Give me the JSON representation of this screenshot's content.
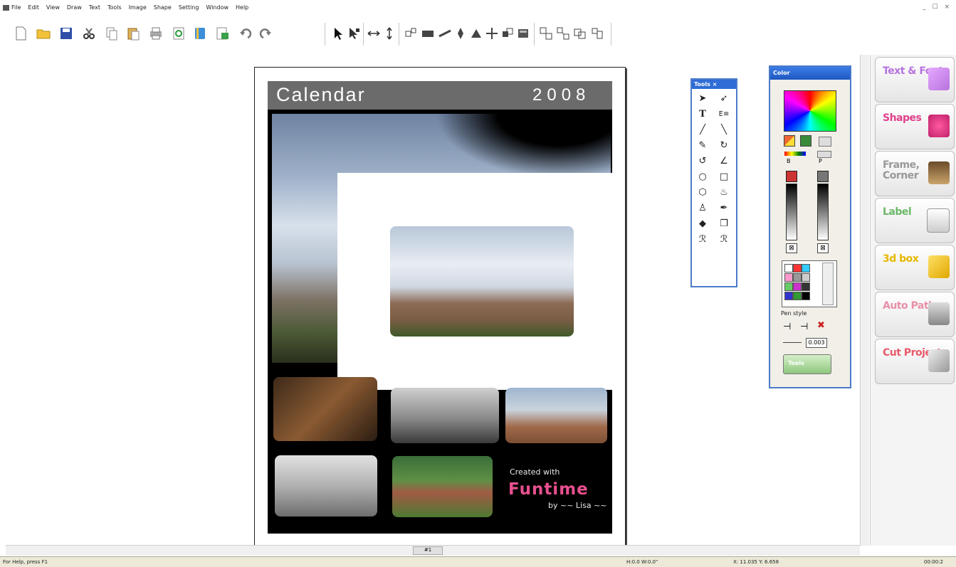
{
  "menu": {
    "items": [
      "File",
      "Edit",
      "View",
      "Draw",
      "Text",
      "Tools",
      "Image",
      "Shape",
      "Setting",
      "Window",
      "Help"
    ],
    "window_controls": "_ ☐ ×"
  },
  "toolbar": {
    "buttons": [
      "new-file",
      "open-folder",
      "save",
      "cut",
      "copy",
      "paste",
      "print",
      "refresh",
      "book",
      "export",
      "undo",
      "redo",
      "select",
      "pointer",
      "flip-horizontal",
      "flip-vertical",
      "align",
      "rectangle",
      "line",
      "point",
      "shape",
      "move",
      "send-back",
      "layer",
      "group",
      "ungroup",
      "combine",
      "arrange"
    ]
  },
  "calendar": {
    "title": "Calendar",
    "year": "2008",
    "created_with": "Created with",
    "brand": "Funtime",
    "byline": "by ~~ Lisa ~~"
  },
  "tools_window": {
    "title": "Tools",
    "close": "×",
    "icons": [
      "arrow-icon",
      "node-icon",
      "text-icon",
      "art-text-icon",
      "line-icon",
      "diagonal-icon",
      "pen-icon",
      "curve-icon",
      "arc-icon",
      "angle-icon",
      "ellipse-icon",
      "rect-icon",
      "polygon-icon",
      "fill-icon",
      "stamp-icon",
      "brush-icon",
      "eraser-icon",
      "copy-icon",
      "zoom-in-icon",
      "zoom-out-icon"
    ]
  },
  "color_window": {
    "title": "Color",
    "brush_label": "B",
    "pen_label": "P",
    "pen_style_label": "Pen style",
    "pen_value": "0.003",
    "tools_button": "Tools"
  },
  "right_panel": {
    "buttons": [
      {
        "label": "Text & Fonts",
        "color": "#c084e0"
      },
      {
        "label": "Shapes",
        "color": "#e0408a"
      },
      {
        "label": "Frame, Corner",
        "color": "#c8c8c8"
      },
      {
        "label": "Label",
        "color": "#7ec87a"
      },
      {
        "label": "3d box",
        "color": "#f2c21a"
      },
      {
        "label": "Auto Path",
        "color": "#f0a0b0"
      },
      {
        "label": "Cut Project",
        "color": "#f06070"
      }
    ]
  },
  "scrollbar": {
    "page_indicator": "#1"
  },
  "status": {
    "help": "For Help, press F1",
    "dims": "H:0.0  W:0.0\"",
    "coords": "X: 11.035  Y: 6.658",
    "time": "00:00:2"
  },
  "colors": {
    "accent": "#2f6cd6",
    "header_gray": "#6b6b6b",
    "brand_pink": "#e8508f"
  }
}
